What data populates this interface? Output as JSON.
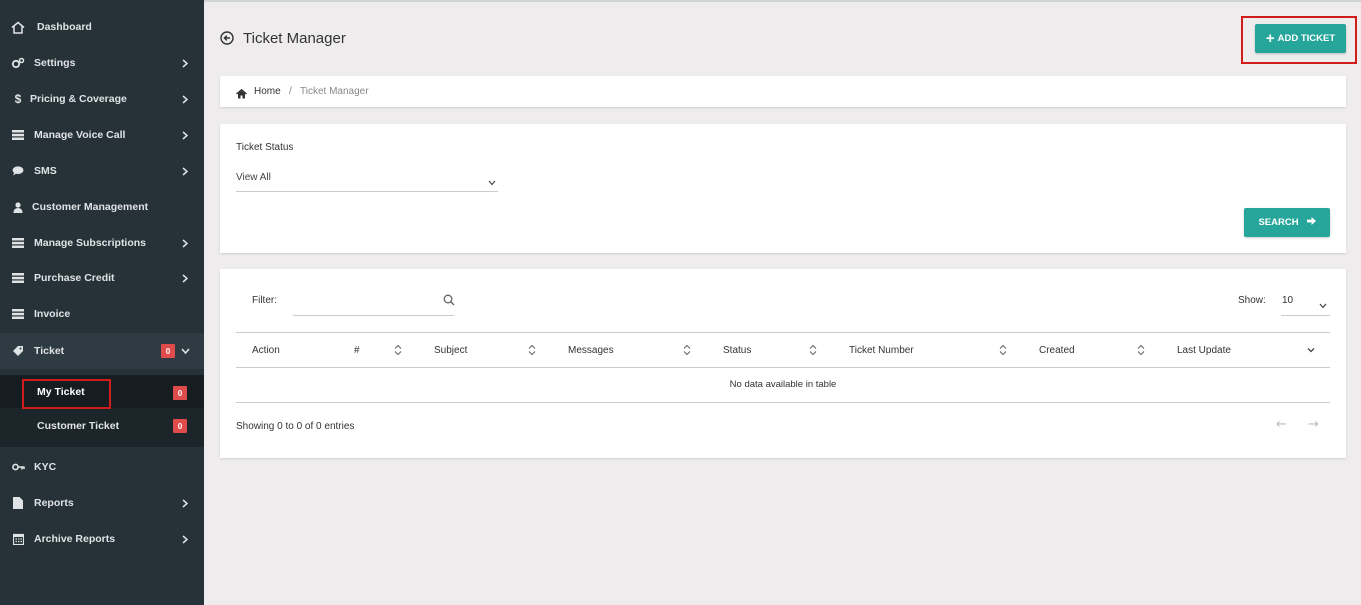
{
  "sidebar": {
    "items": [
      {
        "label": "Dashboard",
        "icon": "home-icon"
      },
      {
        "label": "Settings",
        "icon": "gears-icon"
      },
      {
        "label": "Pricing & Coverage",
        "icon": "dollar-icon"
      },
      {
        "label": "Manage Voice Call",
        "icon": "list-icon"
      },
      {
        "label": "SMS",
        "icon": "chat-icon"
      },
      {
        "label": "Customer Management",
        "icon": "user-icon"
      },
      {
        "label": "Manage Subscriptions",
        "icon": "list-icon"
      },
      {
        "label": "Purchase Credit",
        "icon": "list-icon"
      },
      {
        "label": "Invoice",
        "icon": "list-icon"
      },
      {
        "label": "Ticket",
        "icon": "tag-icon",
        "badge": "0"
      },
      {
        "label": "KYC",
        "icon": "key-icon"
      },
      {
        "label": "Reports",
        "icon": "file-icon"
      },
      {
        "label": "Archive Reports",
        "icon": "calendar-icon"
      }
    ],
    "ticket_sub": [
      {
        "label": "My Ticket",
        "badge": "0"
      },
      {
        "label": "Customer Ticket",
        "badge": "0"
      }
    ]
  },
  "header": {
    "title": "Ticket Manager",
    "add_button": "ADD TICKET"
  },
  "breadcrumb": {
    "home": "Home",
    "separator": "/",
    "current": "Ticket Manager"
  },
  "filter_card": {
    "status_label": "Ticket Status",
    "status_value": "View All",
    "search_button": "SEARCH"
  },
  "table": {
    "filter_label": "Filter:",
    "filter_value": "",
    "show_label": "Show:",
    "show_value": "10",
    "columns": [
      "Action",
      "#",
      "Subject",
      "Messages",
      "Status",
      "Ticket Number",
      "Created",
      "Last Update"
    ],
    "empty_message": "No data available in table",
    "info": "Showing 0 to 0 of 0 entries",
    "prev": "←",
    "next": "→"
  },
  "colors": {
    "sidebar_bg": "#263238",
    "accent": "#26a69a",
    "badge": "#e04b4b",
    "highlight": "#d21b1b"
  }
}
